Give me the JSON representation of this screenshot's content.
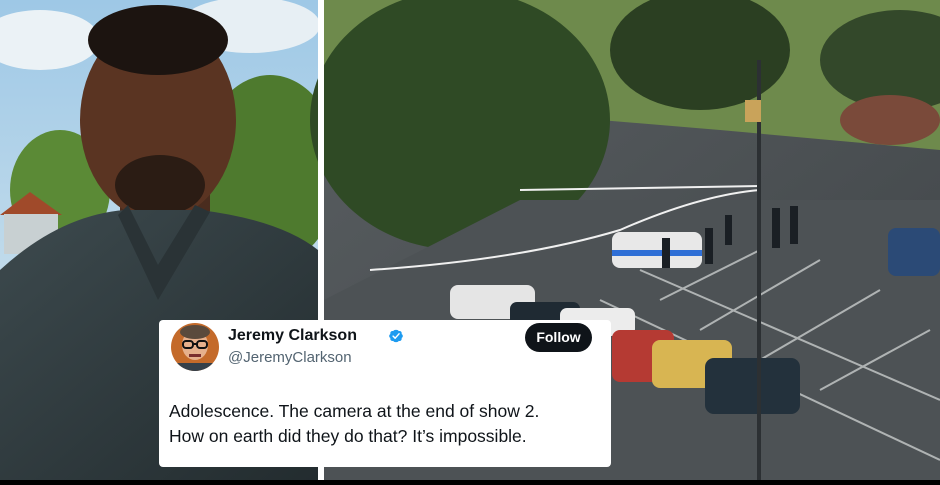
{
  "tweet": {
    "display_name": "Jeremy Clarkson",
    "handle": "@JeremyClarkson",
    "follow_label": "Follow",
    "verified_icon": "verified-badge-icon",
    "text_lines": [
      "Adolescence. The camera at the end of show 2.",
      "How on earth did they do that? It’s impossible."
    ]
  },
  "colors": {
    "follow_button": "#0f1419",
    "handle": "#536471",
    "verified": "#1d9bf0"
  }
}
